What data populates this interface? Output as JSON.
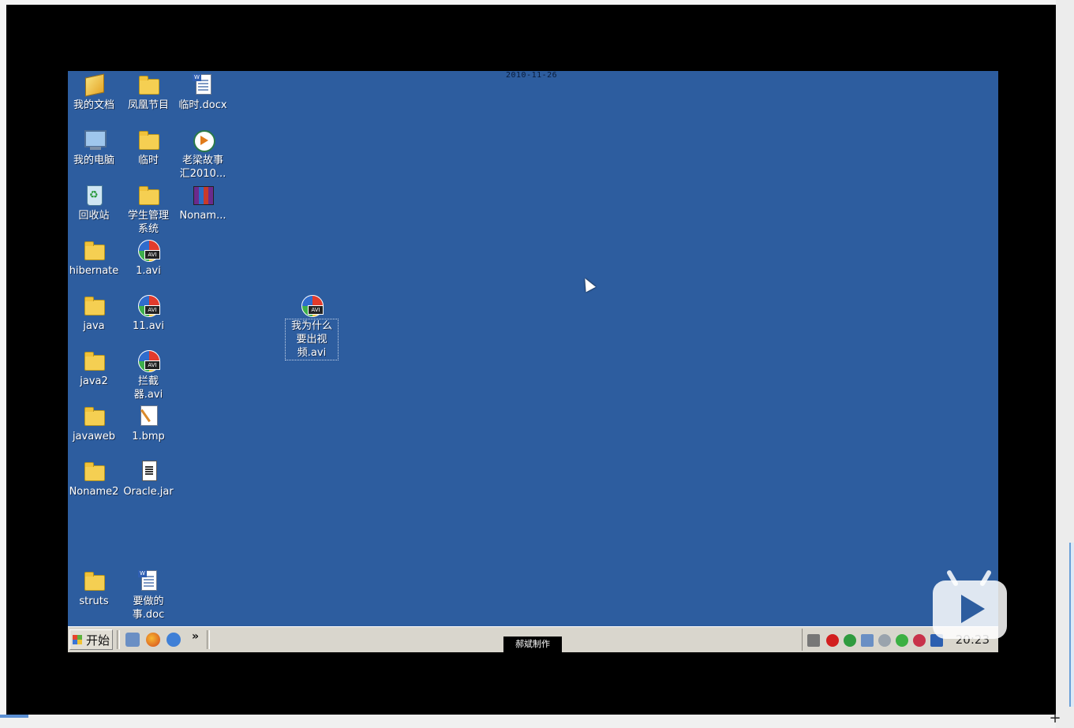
{
  "desktop": {
    "date_stamp": "2010-11-26",
    "icons": {
      "my_documents": "我的文档",
      "phoenix_programs": "凤凰节目",
      "temp_docx": "临时.docx",
      "my_computer": "我的电脑",
      "temp_folder": "临时",
      "story_video": "老梁故事汇2010...",
      "recycle_bin": "回收站",
      "student_mgmt": "学生管理系统",
      "noname_rar": "Nonam...",
      "hibernate": "hibernate",
      "avi_1": "1.avi",
      "java": "java",
      "avi_11": "11.avi",
      "java2": "java2",
      "interceptor_avi": "拦截器.avi",
      "javaweb": "javaweb",
      "bmp_1": "1.bmp",
      "noname2": "Noname2",
      "oracle_jar": "Oracle.jar",
      "struts": "struts",
      "todo_doc": "要做的事.doc",
      "why_video": "我为什么要出视频.avi"
    }
  },
  "taskbar": {
    "start_label": "开始",
    "chevron": "»",
    "overlay_label": "郝斌制作",
    "clock": "20:23"
  },
  "icons_semantic": {
    "play": "play-logo-icon",
    "cursor": "mouse-pointer-icon"
  },
  "colors": {
    "desktop_bg": "#2d5d9f",
    "taskbar_bg": "#d9d6cd"
  }
}
